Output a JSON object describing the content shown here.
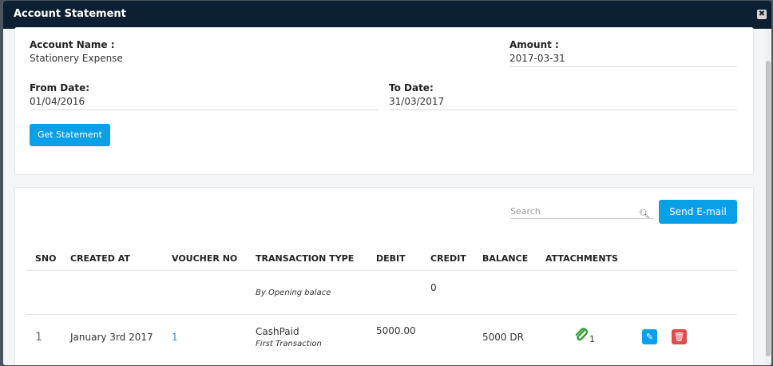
{
  "window": {
    "title": "Account Statement",
    "close_icon": "close-icon"
  },
  "form": {
    "account_name_label": "Account Name :",
    "account_name_value": "Stationery Expense",
    "amount_label": "Amount :",
    "amount_value": "2017-03-31",
    "from_date_label": "From Date:",
    "from_date_value": "01/04/2016",
    "to_date_label": "To Date:",
    "to_date_value": "31/03/2017",
    "get_statement_label": "Get Statement"
  },
  "toolbar": {
    "search_placeholder": "Search",
    "send_email_label": "Send E-mail"
  },
  "table": {
    "headers": [
      "SNO",
      "CREATED AT",
      "VOUCHER NO",
      "TRANSACTION TYPE",
      "DEBIT",
      "CREDIT",
      "BALANCE",
      "ATTACHMENTS"
    ],
    "opening_row": {
      "type_note": "By Opening balace",
      "credit": "0"
    },
    "rows": [
      {
        "sno": "1",
        "created_at": "January 3rd 2017",
        "voucher_no": "1",
        "type": "CashPaid",
        "type_note": "First Transaction",
        "debit": "5000.00",
        "balance": "5000 DR",
        "attachments": "1"
      }
    ]
  },
  "colors": {
    "header_bg": "#0d1f33",
    "primary": "#0aa0e8",
    "danger": "#e04b4b",
    "attach": "#2e9e2e"
  }
}
